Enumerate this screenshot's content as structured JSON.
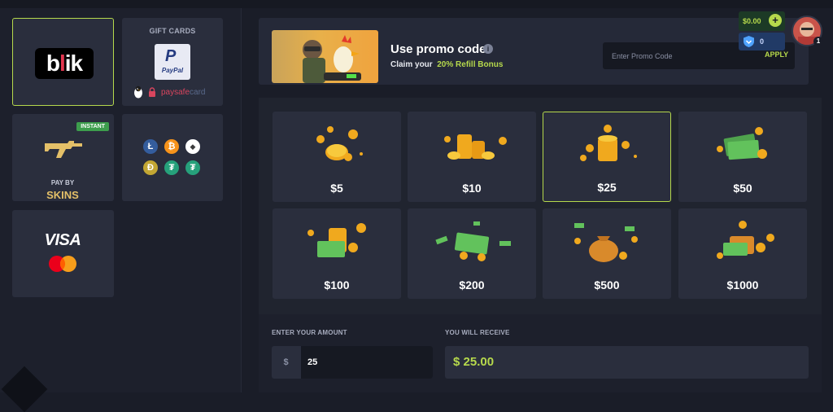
{
  "payment_methods": {
    "blik": {
      "label": "blik",
      "accent": "#e3364f"
    },
    "gift_cards": {
      "title": "GIFT CARDS",
      "paypal": "PayPal",
      "paysafe_a": "paysafe",
      "paysafe_b": "card"
    },
    "skins": {
      "badge": "INSTANT",
      "line1": "PAY BY",
      "line2": "SKINS"
    },
    "crypto": {
      "coins": [
        {
          "sym": "Ł",
          "color": "#345d9d",
          "icon": "litecoin-icon"
        },
        {
          "sym": "₿",
          "color": "#f7931a",
          "icon": "bitcoin-icon"
        },
        {
          "sym": "◆",
          "color": "#ffffff",
          "icon": "ethereum-icon"
        },
        {
          "sym": "Ð",
          "color": "#c2a633",
          "icon": "dogecoin-icon"
        },
        {
          "sym": "₮",
          "color": "#26a17b",
          "icon": "tether-icon"
        },
        {
          "sym": "₮",
          "color": "#26a17b",
          "icon": "tether-tron-icon"
        }
      ]
    },
    "card": {
      "visa": "VISA"
    }
  },
  "promo": {
    "title": "Use promo code",
    "sub_prefix": "Claim your",
    "sub_highlight": "20% Refill Bonus",
    "placeholder": "Enter Promo Code",
    "apply": "APPLY",
    "info_icon": "i"
  },
  "amounts": {
    "selected": "$25",
    "tiles": [
      "$5",
      "$10",
      "$25",
      "$50",
      "$100",
      "$200",
      "$500",
      "$1000"
    ]
  },
  "deposit": {
    "enter_label": "ENTER YOUR AMOUNT",
    "currency": "$",
    "value": "25",
    "receive_label": "YOU WILL RECEIVE",
    "receive_value": "$ 25.00"
  },
  "header": {
    "balance": "$0.00",
    "plus": "+",
    "gems": "0",
    "level": "1"
  },
  "colors": {
    "accent": "#b6d94c",
    "panel": "#2a2e3d",
    "bg": "#1a1d28"
  }
}
